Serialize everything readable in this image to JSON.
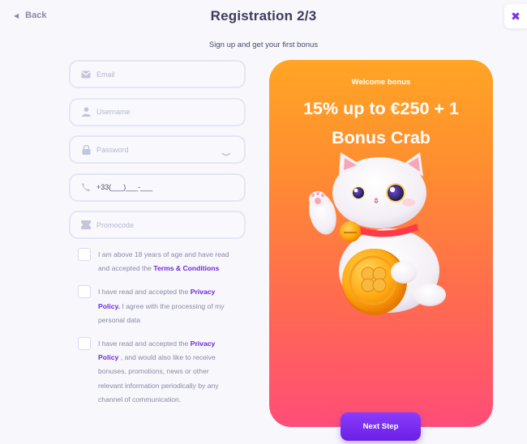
{
  "header": {
    "back_label": "Back",
    "title": "Registration 2/3",
    "close_icon": "close-icon",
    "subtitle": "Sign up and get your first bonus"
  },
  "form": {
    "email_placeholder": "Email",
    "username_placeholder": "Username",
    "password_placeholder": "Password",
    "phone_value": "+33(___)___-___",
    "promocode_placeholder": "Promocode"
  },
  "consents": [
    {
      "text1": "I am above 18 years of age and have read and accepted the ",
      "link": "Terms & Conditions",
      "text2": ""
    },
    {
      "text1": "I have read and accepted the ",
      "link": "Privacy Policy.",
      "text2": " I agree with the processing of my personal data"
    },
    {
      "text1": "I have read and accepted the ",
      "link": "Privacy Policy",
      "text2": " , and would also like to receive bonuses, promotions, news or other relevant information periodically by any channel of communication."
    }
  ],
  "promo": {
    "label": "Welcome bonus",
    "headline_line1": "15% up to €250 + 1",
    "headline_line2": "Bonus Crab"
  },
  "actions": {
    "next_label": "Next Step"
  },
  "colors": {
    "accent": "#6d2ae0",
    "promo_top": "#ffa524",
    "promo_bottom": "#ff4d78"
  }
}
